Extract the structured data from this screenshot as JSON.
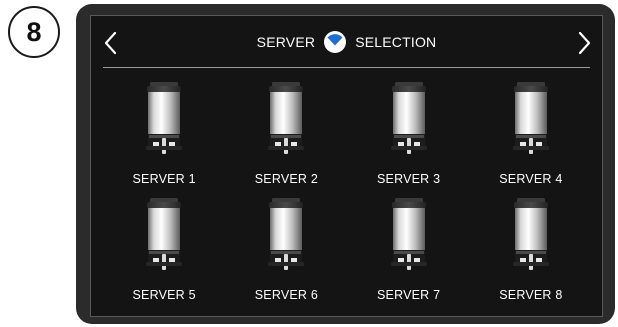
{
  "step_number": "8",
  "header": {
    "title_left": "SERVER",
    "title_right": "SELECTION",
    "prev_icon": "chevron-left-icon",
    "next_icon": "chevron-right-icon",
    "logo_icon": "brand-logo-icon"
  },
  "servers": [
    {
      "label": "SERVER 1"
    },
    {
      "label": "SERVER 2"
    },
    {
      "label": "SERVER 3"
    },
    {
      "label": "SERVER 4"
    },
    {
      "label": "SERVER 5"
    },
    {
      "label": "SERVER 6"
    },
    {
      "label": "SERVER 7"
    },
    {
      "label": "SERVER 8"
    }
  ],
  "colors": {
    "screen_bg": "#141414",
    "bezel": "#2b2b2b",
    "accent": "#1f6fd1",
    "text": "#ffffff"
  }
}
